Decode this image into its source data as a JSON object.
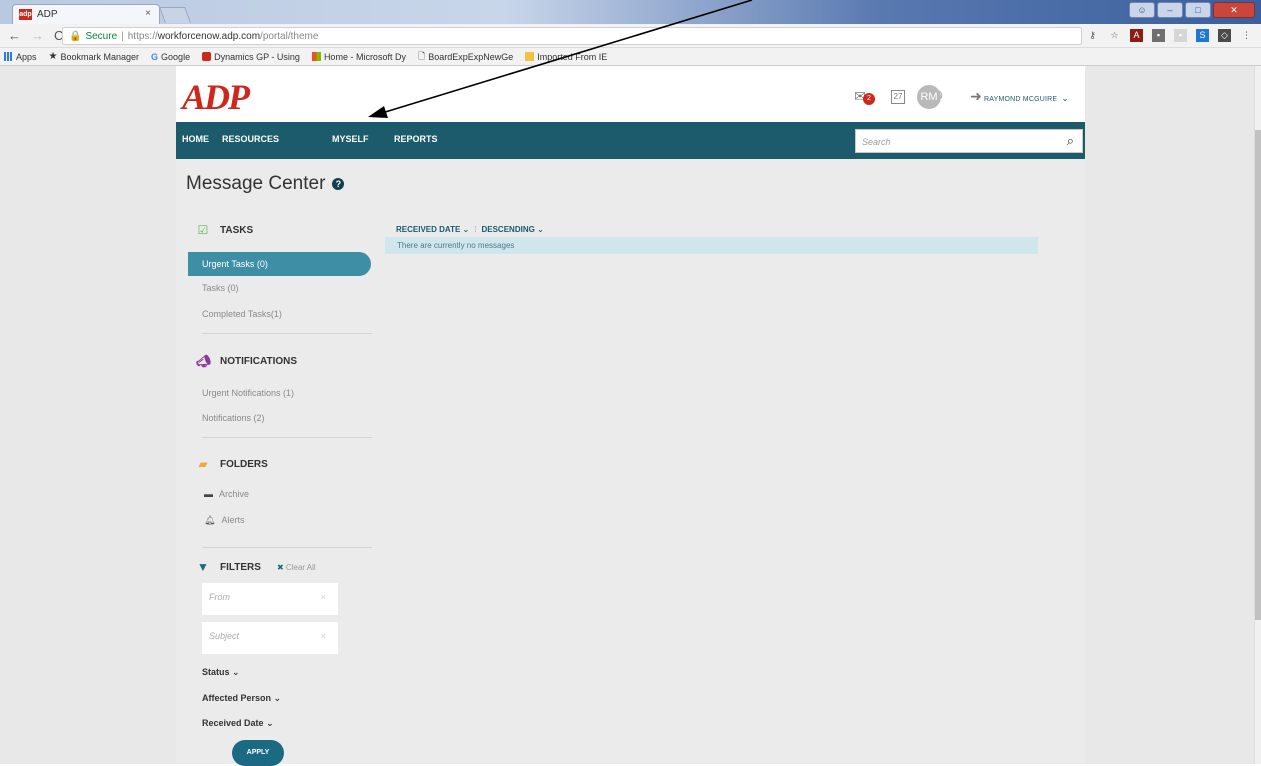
{
  "browser": {
    "tab_title": "ADP",
    "tab_favicon": "adp-favicon",
    "secure_label": "Secure",
    "url_scheme": "https://",
    "url_host": "workforcenow.adp.com",
    "url_path": "/portal/theme",
    "bookmarks": [
      "Apps",
      "Bookmark Manager",
      "Google",
      "Dynamics GP - Using",
      "Home - Microsoft Dy",
      "BoardExpExpNewGe",
      "Imported From IE"
    ]
  },
  "header": {
    "logo": "ADP",
    "mail_badge_count": "2",
    "calendar_day": "27",
    "avatar_initials": "RM",
    "user_name": "RAYMOND MCGUIRE"
  },
  "nav": {
    "items": [
      "HOME",
      "RESOURCES",
      "MYSELF",
      "REPORTS"
    ],
    "search_placeholder": "Search"
  },
  "page": {
    "title": "Message Center"
  },
  "sidebar": {
    "tasks": {
      "heading": "TASKS",
      "items": [
        "Urgent Tasks (0)",
        "Tasks (0)",
        "Completed Tasks(1)"
      ]
    },
    "notifications": {
      "heading": "NOTIFICATIONS",
      "items": [
        "Urgent Notifications (1)",
        "Notifications (2)"
      ]
    },
    "folders": {
      "heading": "FOLDERS",
      "items": [
        "Archive",
        "Alerts"
      ]
    },
    "filters": {
      "heading": "FILTERS",
      "clear_all": "Clear All",
      "from_placeholder": "From",
      "subject_placeholder": "Subject",
      "dropdowns": [
        "Status",
        "Affected Person",
        "Received Date"
      ],
      "apply": "APPLY"
    }
  },
  "messages": {
    "sort_field": "RECEIVED DATE",
    "sort_order": "DESCENDING",
    "empty_text": "There are currently no messages"
  },
  "colors": {
    "brand_red": "#d0271d",
    "nav_teal": "#1b5b6c",
    "active_teal": "#3e8fa5"
  }
}
